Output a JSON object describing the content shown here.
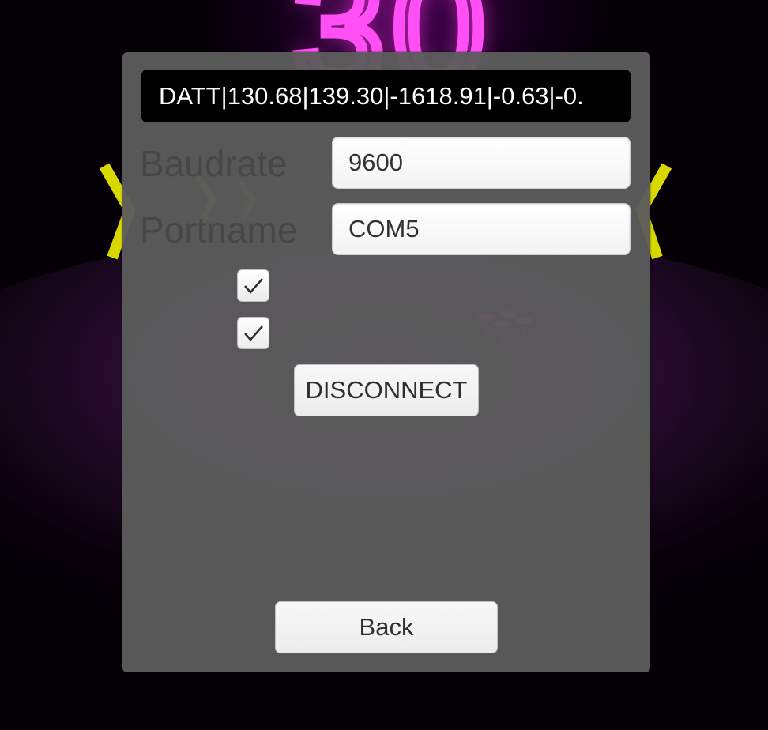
{
  "status_line": "DATT|130.68|139.30|-1618.91|-0.63|-0.",
  "baudrate": {
    "label": "Baudrate",
    "value": "9600"
  },
  "portname": {
    "label": "Portname",
    "value": "COM5"
  },
  "checkboxes": [
    {
      "checked": true
    },
    {
      "checked": true
    }
  ],
  "buttons": {
    "connect_label": "DISCONNECT",
    "back_label": "Back"
  },
  "background": {
    "score": "30"
  },
  "colors": {
    "panel": "#5c5c5c",
    "label_text": "#474747",
    "neon_magenta": "#ff4ff5",
    "neon_yellow": "#e6e600"
  }
}
